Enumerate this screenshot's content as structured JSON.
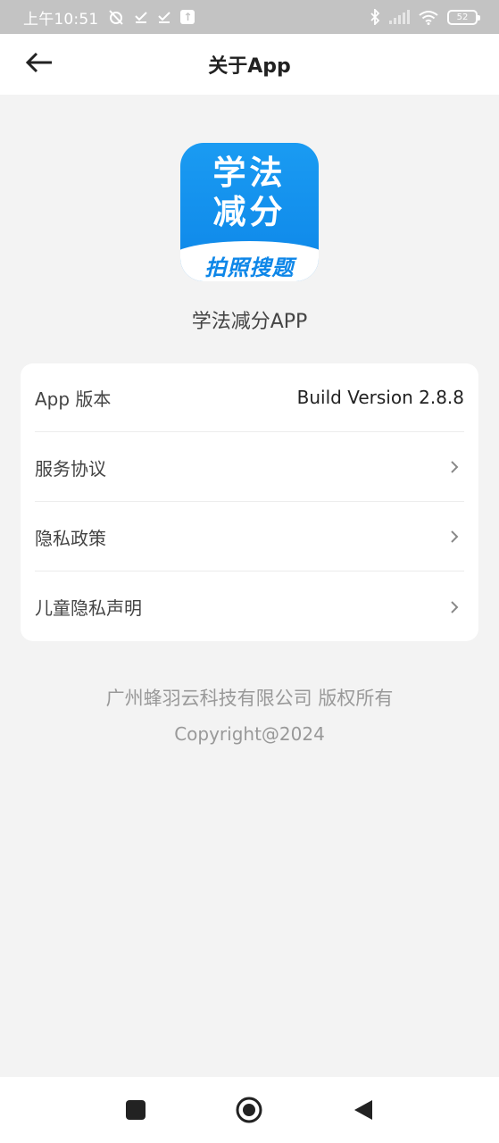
{
  "status_bar": {
    "time": "上午10:51",
    "battery": "52",
    "icons": [
      "alarm-off-icon",
      "download-done-icon",
      "download-done-icon",
      "upload-icon",
      "bluetooth-icon",
      "signal-icon",
      "wifi-icon",
      "battery-icon"
    ]
  },
  "header": {
    "title": "关于App",
    "back_icon": "arrow-left-icon"
  },
  "logo": {
    "line1": "学法",
    "line2": "减分",
    "banner": "拍照搜题"
  },
  "app_name": "学法减分APP",
  "info": {
    "version_label": "App 版本",
    "version_value": "Build Version 2.8.8",
    "items": [
      {
        "label": "服务协议"
      },
      {
        "label": "隐私政策"
      },
      {
        "label": "儿童隐私声明"
      }
    ]
  },
  "footer": {
    "company": "广州蜂羽云科技有限公司 版权所有",
    "copyright": "Copyright@2024"
  },
  "nav": {
    "recent": "square-icon",
    "home": "circle-icon",
    "back": "triangle-back-icon"
  },
  "colors": {
    "accent": "#0d86e8",
    "background": "#f3f3f3",
    "status_bar": "#c3c3c3"
  }
}
